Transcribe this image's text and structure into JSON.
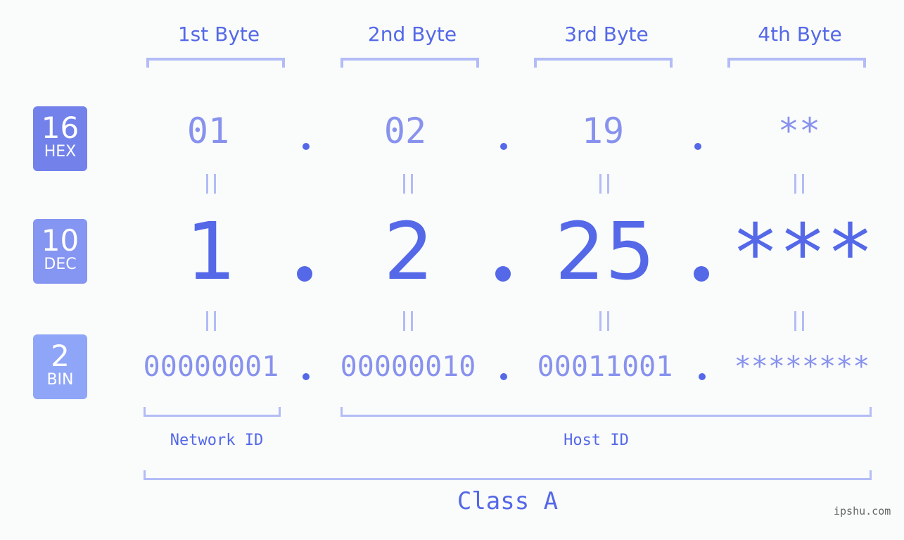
{
  "bytes": [
    {
      "label": "1st Byte",
      "hex": "01",
      "dec": "1",
      "bin": "00000001"
    },
    {
      "label": "2nd Byte",
      "hex": "02",
      "dec": "2",
      "bin": "00000010"
    },
    {
      "label": "3rd Byte",
      "hex": "19",
      "dec": "25",
      "bin": "00011001"
    },
    {
      "label": "4th Byte",
      "hex": "**",
      "dec": "***",
      "bin": "********"
    }
  ],
  "badges": {
    "hex": {
      "num": "16",
      "unit": "HEX",
      "color": "#7282ea"
    },
    "dec": {
      "num": "10",
      "unit": "DEC",
      "color": "#8595f2"
    },
    "bin": {
      "num": "2",
      "unit": "BIN",
      "color": "#8fa5f7"
    }
  },
  "network_label": "Network ID",
  "host_label": "Host ID",
  "class_label": "Class A",
  "watermark": "ipshu.com",
  "colors": {
    "primary": "#5468e8",
    "value": "#8892ee",
    "bracket": "#b3bcf7",
    "background": "#fafcfb"
  }
}
